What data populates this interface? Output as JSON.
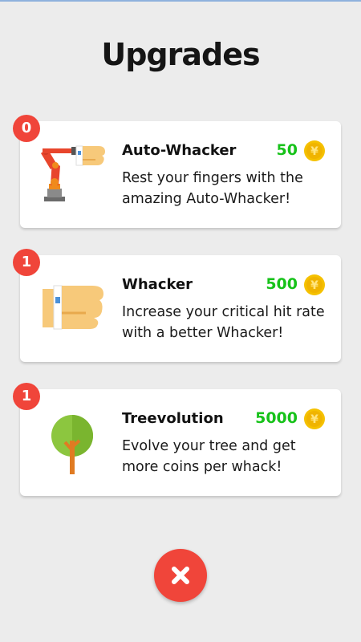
{
  "title": "Upgrades",
  "upgrades": [
    {
      "level": "0",
      "name": "Auto-Whacker",
      "price": "50",
      "description": "Rest your fingers with the amazing Auto-Whacker!",
      "icon": "robot-arm-icon"
    },
    {
      "level": "1",
      "name": "Whacker",
      "price": "500",
      "description": "Increase your critical hit rate with a better Whacker!",
      "icon": "fist-icon"
    },
    {
      "level": "1",
      "name": "Treevolution",
      "price": "5000",
      "description": "Evolve your tree and get more coins per whack!",
      "icon": "tree-icon"
    }
  ],
  "close_icon": "close-icon",
  "colors": {
    "background": "#ececec",
    "badge": "#f0453a",
    "price": "#17c21a",
    "coin": "#f5c100",
    "close_button": "#f0453a"
  }
}
